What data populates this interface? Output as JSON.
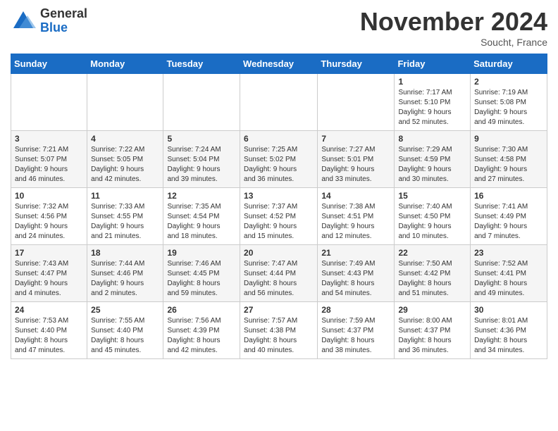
{
  "header": {
    "logo_general": "General",
    "logo_blue": "Blue",
    "month_title": "November 2024",
    "location": "Soucht, France"
  },
  "weekdays": [
    "Sunday",
    "Monday",
    "Tuesday",
    "Wednesday",
    "Thursday",
    "Friday",
    "Saturday"
  ],
  "weeks": [
    [
      {
        "day": "",
        "info": ""
      },
      {
        "day": "",
        "info": ""
      },
      {
        "day": "",
        "info": ""
      },
      {
        "day": "",
        "info": ""
      },
      {
        "day": "",
        "info": ""
      },
      {
        "day": "1",
        "info": "Sunrise: 7:17 AM\nSunset: 5:10 PM\nDaylight: 9 hours\nand 52 minutes."
      },
      {
        "day": "2",
        "info": "Sunrise: 7:19 AM\nSunset: 5:08 PM\nDaylight: 9 hours\nand 49 minutes."
      }
    ],
    [
      {
        "day": "3",
        "info": "Sunrise: 7:21 AM\nSunset: 5:07 PM\nDaylight: 9 hours\nand 46 minutes."
      },
      {
        "day": "4",
        "info": "Sunrise: 7:22 AM\nSunset: 5:05 PM\nDaylight: 9 hours\nand 42 minutes."
      },
      {
        "day": "5",
        "info": "Sunrise: 7:24 AM\nSunset: 5:04 PM\nDaylight: 9 hours\nand 39 minutes."
      },
      {
        "day": "6",
        "info": "Sunrise: 7:25 AM\nSunset: 5:02 PM\nDaylight: 9 hours\nand 36 minutes."
      },
      {
        "day": "7",
        "info": "Sunrise: 7:27 AM\nSunset: 5:01 PM\nDaylight: 9 hours\nand 33 minutes."
      },
      {
        "day": "8",
        "info": "Sunrise: 7:29 AM\nSunset: 4:59 PM\nDaylight: 9 hours\nand 30 minutes."
      },
      {
        "day": "9",
        "info": "Sunrise: 7:30 AM\nSunset: 4:58 PM\nDaylight: 9 hours\nand 27 minutes."
      }
    ],
    [
      {
        "day": "10",
        "info": "Sunrise: 7:32 AM\nSunset: 4:56 PM\nDaylight: 9 hours\nand 24 minutes."
      },
      {
        "day": "11",
        "info": "Sunrise: 7:33 AM\nSunset: 4:55 PM\nDaylight: 9 hours\nand 21 minutes."
      },
      {
        "day": "12",
        "info": "Sunrise: 7:35 AM\nSunset: 4:54 PM\nDaylight: 9 hours\nand 18 minutes."
      },
      {
        "day": "13",
        "info": "Sunrise: 7:37 AM\nSunset: 4:52 PM\nDaylight: 9 hours\nand 15 minutes."
      },
      {
        "day": "14",
        "info": "Sunrise: 7:38 AM\nSunset: 4:51 PM\nDaylight: 9 hours\nand 12 minutes."
      },
      {
        "day": "15",
        "info": "Sunrise: 7:40 AM\nSunset: 4:50 PM\nDaylight: 9 hours\nand 10 minutes."
      },
      {
        "day": "16",
        "info": "Sunrise: 7:41 AM\nSunset: 4:49 PM\nDaylight: 9 hours\nand 7 minutes."
      }
    ],
    [
      {
        "day": "17",
        "info": "Sunrise: 7:43 AM\nSunset: 4:47 PM\nDaylight: 9 hours\nand 4 minutes."
      },
      {
        "day": "18",
        "info": "Sunrise: 7:44 AM\nSunset: 4:46 PM\nDaylight: 9 hours\nand 2 minutes."
      },
      {
        "day": "19",
        "info": "Sunrise: 7:46 AM\nSunset: 4:45 PM\nDaylight: 8 hours\nand 59 minutes."
      },
      {
        "day": "20",
        "info": "Sunrise: 7:47 AM\nSunset: 4:44 PM\nDaylight: 8 hours\nand 56 minutes."
      },
      {
        "day": "21",
        "info": "Sunrise: 7:49 AM\nSunset: 4:43 PM\nDaylight: 8 hours\nand 54 minutes."
      },
      {
        "day": "22",
        "info": "Sunrise: 7:50 AM\nSunset: 4:42 PM\nDaylight: 8 hours\nand 51 minutes."
      },
      {
        "day": "23",
        "info": "Sunrise: 7:52 AM\nSunset: 4:41 PM\nDaylight: 8 hours\nand 49 minutes."
      }
    ],
    [
      {
        "day": "24",
        "info": "Sunrise: 7:53 AM\nSunset: 4:40 PM\nDaylight: 8 hours\nand 47 minutes."
      },
      {
        "day": "25",
        "info": "Sunrise: 7:55 AM\nSunset: 4:40 PM\nDaylight: 8 hours\nand 45 minutes."
      },
      {
        "day": "26",
        "info": "Sunrise: 7:56 AM\nSunset: 4:39 PM\nDaylight: 8 hours\nand 42 minutes."
      },
      {
        "day": "27",
        "info": "Sunrise: 7:57 AM\nSunset: 4:38 PM\nDaylight: 8 hours\nand 40 minutes."
      },
      {
        "day": "28",
        "info": "Sunrise: 7:59 AM\nSunset: 4:37 PM\nDaylight: 8 hours\nand 38 minutes."
      },
      {
        "day": "29",
        "info": "Sunrise: 8:00 AM\nSunset: 4:37 PM\nDaylight: 8 hours\nand 36 minutes."
      },
      {
        "day": "30",
        "info": "Sunrise: 8:01 AM\nSunset: 4:36 PM\nDaylight: 8 hours\nand 34 minutes."
      }
    ]
  ]
}
